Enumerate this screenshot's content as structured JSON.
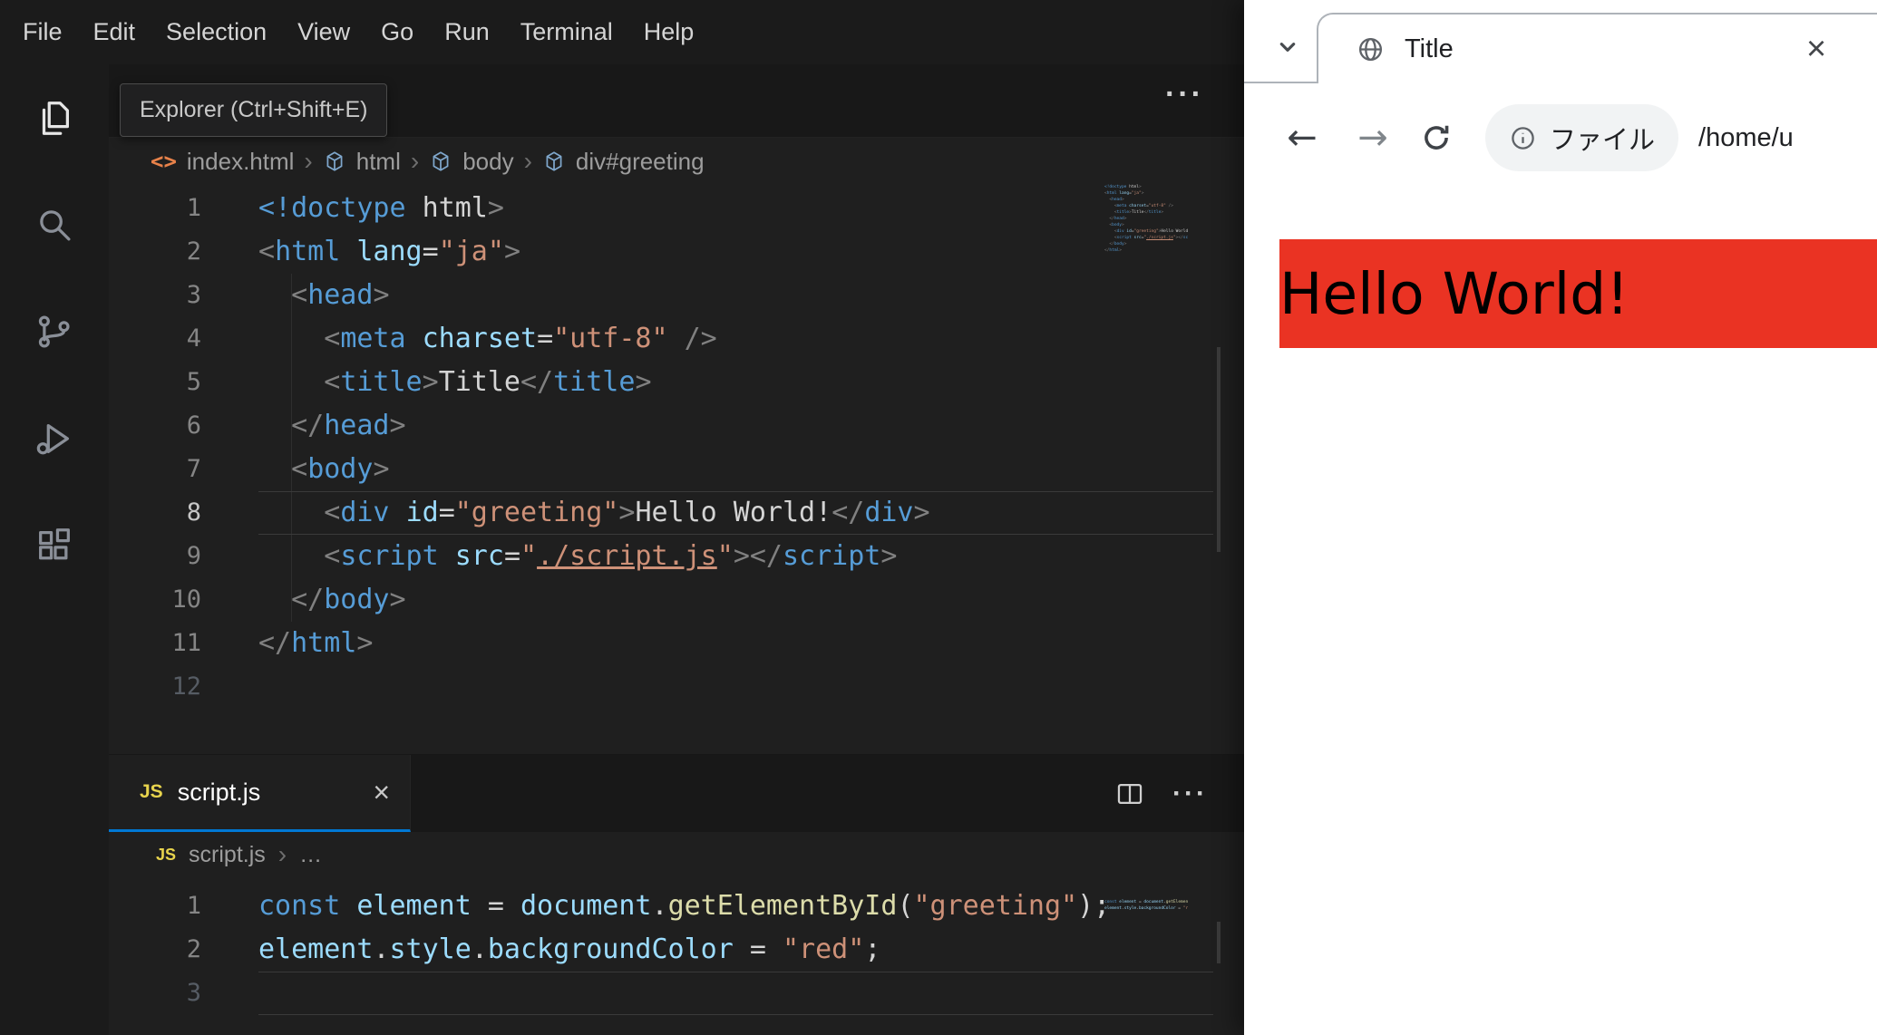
{
  "colors": {
    "accent": "#0078d4",
    "red": "#ea3323"
  },
  "icons": {
    "more": "···",
    "close": "×",
    "chevron_sep": "›",
    "ellipsis": "…",
    "html_file": "<>",
    "back": "←",
    "forward": "→",
    "js_badge": "JS"
  },
  "vscode": {
    "menu": [
      "File",
      "Edit",
      "Selection",
      "View",
      "Go",
      "Run",
      "Terminal",
      "Help"
    ],
    "tooltip": "Explorer (Ctrl+Shift+E)",
    "breadcrumb": {
      "file": "index.html",
      "segments": [
        "html",
        "body",
        "div#greeting"
      ]
    },
    "panel_tab": "script.js",
    "js_breadcrumb": "script.js",
    "html_lines": [
      {
        "n": 1,
        "t": [
          [
            "<!doctype",
            "tag"
          ],
          [
            " html",
            "txt"
          ],
          [
            ">",
            "pt"
          ]
        ]
      },
      {
        "n": 2,
        "t": [
          [
            "<",
            "pt"
          ],
          [
            "html",
            "tag"
          ],
          [
            " ",
            "txt"
          ],
          [
            "lang",
            "attr"
          ],
          [
            "=",
            "op"
          ],
          [
            "\"ja\"",
            "str"
          ],
          [
            ">",
            "pt"
          ]
        ]
      },
      {
        "n": 3,
        "t": [
          [
            "  ",
            "txt"
          ],
          [
            "<",
            "pt"
          ],
          [
            "head",
            "tag"
          ],
          [
            ">",
            "pt"
          ]
        ]
      },
      {
        "n": 4,
        "t": [
          [
            "    ",
            "txt"
          ],
          [
            "<",
            "pt"
          ],
          [
            "meta",
            "tag"
          ],
          [
            " ",
            "txt"
          ],
          [
            "charset",
            "attr"
          ],
          [
            "=",
            "op"
          ],
          [
            "\"utf-8\"",
            "str"
          ],
          [
            " ",
            "txt"
          ],
          [
            "/>",
            "pt"
          ]
        ]
      },
      {
        "n": 5,
        "t": [
          [
            "    ",
            "txt"
          ],
          [
            "<",
            "pt"
          ],
          [
            "title",
            "tag"
          ],
          [
            ">",
            "pt"
          ],
          [
            "Title",
            "txt"
          ],
          [
            "</",
            "pt"
          ],
          [
            "title",
            "tag"
          ],
          [
            ">",
            "pt"
          ]
        ]
      },
      {
        "n": 6,
        "t": [
          [
            "  ",
            "txt"
          ],
          [
            "</",
            "pt"
          ],
          [
            "head",
            "tag"
          ],
          [
            ">",
            "pt"
          ]
        ]
      },
      {
        "n": 7,
        "t": [
          [
            "  ",
            "txt"
          ],
          [
            "<",
            "pt"
          ],
          [
            "body",
            "tag"
          ],
          [
            ">",
            "pt"
          ]
        ]
      },
      {
        "n": 8,
        "cur": true,
        "act": true,
        "t": [
          [
            "    ",
            "txt"
          ],
          [
            "<",
            "pt"
          ],
          [
            "div",
            "tag"
          ],
          [
            " ",
            "txt"
          ],
          [
            "id",
            "attr"
          ],
          [
            "=",
            "op"
          ],
          [
            "\"greeting\"",
            "str"
          ],
          [
            ">",
            "pt"
          ],
          [
            "Hello World!",
            "txt"
          ],
          [
            "</",
            "pt"
          ],
          [
            "div",
            "tag"
          ],
          [
            ">",
            "pt"
          ]
        ]
      },
      {
        "n": 9,
        "t": [
          [
            "    ",
            "txt"
          ],
          [
            "<",
            "pt"
          ],
          [
            "script",
            "tag"
          ],
          [
            " ",
            "txt"
          ],
          [
            "src",
            "attr"
          ],
          [
            "=",
            "op"
          ],
          [
            "\"",
            "str"
          ],
          [
            "./script.js",
            "link"
          ],
          [
            "\"",
            "str"
          ],
          [
            ">",
            "pt"
          ],
          [
            "</",
            "pt"
          ],
          [
            "script",
            "tag"
          ],
          [
            ">",
            "pt"
          ]
        ]
      },
      {
        "n": 10,
        "t": [
          [
            "  ",
            "txt"
          ],
          [
            "</",
            "pt"
          ],
          [
            "body",
            "tag"
          ],
          [
            ">",
            "pt"
          ]
        ]
      },
      {
        "n": 11,
        "t": [
          [
            "</",
            "pt"
          ],
          [
            "html",
            "tag"
          ],
          [
            ">",
            "pt"
          ]
        ]
      },
      {
        "n": 12,
        "dim": true,
        "t": []
      }
    ],
    "js_lines": [
      {
        "n": 1,
        "t": [
          [
            "const",
            "kw"
          ],
          [
            " ",
            "txt"
          ],
          [
            "element",
            "var"
          ],
          [
            " = ",
            "op"
          ],
          [
            "document",
            "var"
          ],
          [
            ".",
            "op"
          ],
          [
            "getElementById",
            "fn"
          ],
          [
            "(",
            "op"
          ],
          [
            "\"greeting\"",
            "str"
          ],
          [
            ");",
            "op"
          ]
        ]
      },
      {
        "n": 2,
        "t": [
          [
            "element",
            "var"
          ],
          [
            ".",
            "op"
          ],
          [
            "style",
            "var"
          ],
          [
            ".",
            "op"
          ],
          [
            "backgroundColor",
            "var"
          ],
          [
            " = ",
            "op"
          ],
          [
            "\"red\"",
            "str"
          ],
          [
            ";",
            "op"
          ]
        ]
      },
      {
        "n": 3,
        "dim": true,
        "cur": true,
        "t": []
      }
    ]
  },
  "browser": {
    "tab_title": "Title",
    "chip": "ファイル",
    "url": "/home/u",
    "page": {
      "text": "Hello World!"
    }
  }
}
